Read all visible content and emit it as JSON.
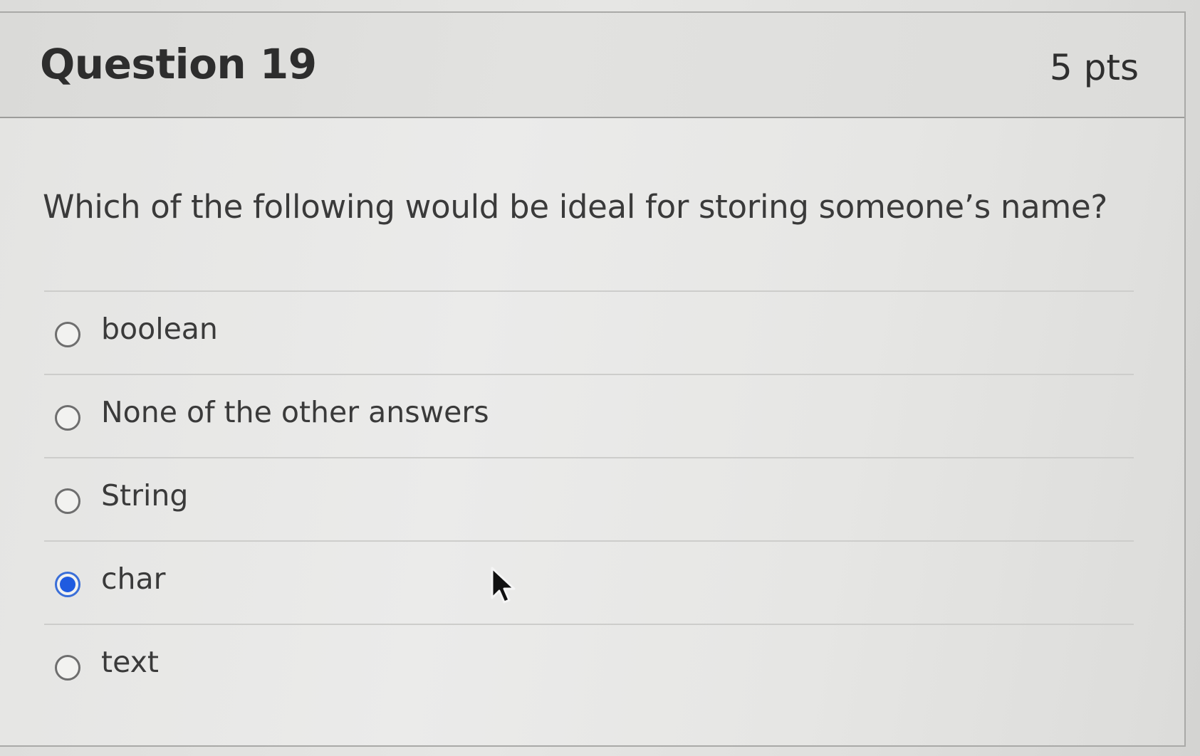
{
  "question": {
    "title": "Question 19",
    "points": "5 pts",
    "text": "Which of the following would be ideal for storing someone’s name?"
  },
  "answers": [
    {
      "label": "boolean",
      "selected": false
    },
    {
      "label": "None of the other answers",
      "selected": false
    },
    {
      "label": "String",
      "selected": false
    },
    {
      "label": "char",
      "selected": true
    },
    {
      "label": "text",
      "selected": false
    }
  ],
  "colors": {
    "selected_radio": "#1f5be0",
    "text": "#3a3a3a"
  }
}
